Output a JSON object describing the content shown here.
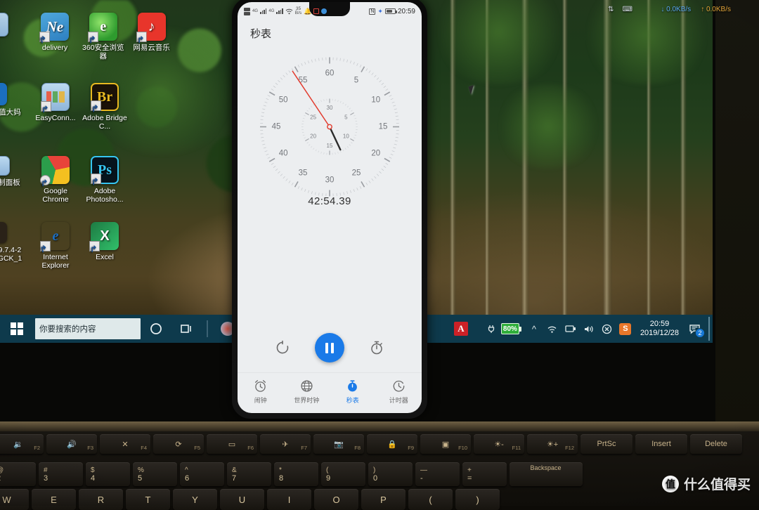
{
  "desktop": {
    "icons": [
      {
        "label": "delivery",
        "icon": "ne-delivery-icon",
        "glyph": "Ne",
        "cls": "g-delivery"
      },
      {
        "label": "360安全浏览器",
        "icon": "360-browser-icon",
        "glyph": "e",
        "cls": "g-360"
      },
      {
        "label": "网易云音乐",
        "icon": "netease-music-icon",
        "glyph": "♪",
        "cls": "g-netease"
      },
      {
        "label": "值大妈",
        "icon": "smzdm-icon",
        "glyph": "",
        "cls": "g-blue"
      },
      {
        "label": "EasyConn...",
        "icon": "easyconnect-icon",
        "glyph": "",
        "cls": "g-easyconn"
      },
      {
        "label": "Adobe Bridge C...",
        "icon": "adobe-bridge-icon",
        "glyph": "Br",
        "cls": "g-br"
      },
      {
        "label": "制面板",
        "icon": "control-panel-icon",
        "glyph": "",
        "cls": "g-panel"
      },
      {
        "label": "Google Chrome",
        "icon": "chrome-icon",
        "glyph": "",
        "cls": "g-chrome"
      },
      {
        "label": "Adobe Photosho...",
        "icon": "adobe-photoshop-icon",
        "glyph": "Ps",
        "cls": "g-ps"
      },
      {
        "label": "9.7.4-2 GCK_1",
        "icon": "folder-icon",
        "glyph": "",
        "cls": "g-blue"
      },
      {
        "label": "Internet Explorer",
        "icon": "internet-explorer-icon",
        "glyph": "e",
        "cls": "g-ie"
      },
      {
        "label": "Excel",
        "icon": "excel-icon",
        "glyph": "X",
        "cls": "g-excel"
      }
    ]
  },
  "taskbar": {
    "search_placeholder": "你要搜索的内容",
    "cortana_icon": "cortana-circle-icon",
    "taskview_icon": "task-view-icon",
    "tray": {
      "acrobat_icon": "adobe-acrobat-icon",
      "plug_icon": "power-plug-icon",
      "battery_percent": "80%",
      "chevron_icon": "chevron-up-icon",
      "wifi_icon": "wifi-icon",
      "screen_icon": "display-icon",
      "volume_icon": "volume-icon",
      "close_icon": "circle-x-icon",
      "sogou_icon": "sogou-icon"
    },
    "clock_time": "20:59",
    "clock_date": "2019/12/28",
    "notification_count": "2"
  },
  "netspeed": {
    "download": "0.0KB/s",
    "upload": "0.0KB/s",
    "down_arrow": "↓",
    "up_arrow": "↑"
  },
  "phone": {
    "statusbar": {
      "sim_label_1": "4G",
      "sim_label_2": "4G",
      "speed_value": "35",
      "speed_unit": "B/s",
      "wifi_icon": "wifi-icon",
      "bell_icon": "bell-icon",
      "square_icon": "red-square-icon",
      "blue_dot_icon": "blue-dot-icon",
      "nfc_icon": "nfc-icon",
      "bluetooth_icon": "bluetooth-icon",
      "battery_icon": "battery-icon",
      "time": "20:59"
    },
    "app_title": "秒表",
    "elapsed": "42:54.39",
    "controls": {
      "lap_icon": "lap-reset-icon",
      "pause_icon": "pause-icon",
      "stopwatch_icon": "stopwatch-icon"
    },
    "nav": [
      {
        "label": "闹钟",
        "icon": "alarm-clock-icon",
        "active": false
      },
      {
        "label": "世界时钟",
        "icon": "globe-icon",
        "active": false
      },
      {
        "label": "秒表",
        "icon": "stopwatch-icon",
        "active": true
      },
      {
        "label": "计时器",
        "icon": "timer-icon",
        "active": false
      }
    ],
    "accent_color": "#1a7ae8",
    "hand_color": "#e23b2e"
  },
  "dial": {
    "outer_ticks_labels": [
      "60",
      "5",
      "10",
      "15",
      "20",
      "25",
      "30",
      "35",
      "40",
      "45",
      "50",
      "55"
    ],
    "inner_ticks_labels": [
      "30",
      "5",
      "10",
      "15",
      "20",
      "25"
    ],
    "second_hand_value": 54.39,
    "minute_hand_value": 12.9,
    "outer_max": 60,
    "inner_max": 30
  },
  "keyboard": {
    "fn_row": [
      {
        "glyph": "🔉",
        "label": "F2",
        "name": "volume-down-key"
      },
      {
        "glyph": "🔊",
        "label": "F3",
        "name": "volume-up-key"
      },
      {
        "glyph": "✕",
        "label": "F4",
        "name": "mic-mute-key"
      },
      {
        "glyph": "⟳",
        "label": "F5",
        "name": "refresh-key"
      },
      {
        "glyph": "▭",
        "label": "F6",
        "name": "touchpad-key"
      },
      {
        "glyph": "✈",
        "label": "F7",
        "name": "airplane-mode-key"
      },
      {
        "glyph": "📷",
        "label": "F8",
        "name": "camera-key"
      },
      {
        "glyph": "🔒",
        "label": "F9",
        "name": "lock-key"
      },
      {
        "glyph": "▣",
        "label": "F10",
        "name": "display-switch-key"
      },
      {
        "glyph": "☀-",
        "label": "F11",
        "name": "brightness-down-key"
      },
      {
        "glyph": "☀+",
        "label": "F12",
        "name": "brightness-up-key"
      },
      {
        "glyph": "PrtSc",
        "label": "",
        "name": "print-screen-key"
      },
      {
        "glyph": "Insert",
        "label": "",
        "name": "insert-key"
      },
      {
        "glyph": "Delete",
        "label": "",
        "name": "delete-key"
      }
    ],
    "num_row": [
      {
        "top": "@",
        "bot": "2"
      },
      {
        "top": "#",
        "bot": "3"
      },
      {
        "top": "$",
        "bot": "4"
      },
      {
        "top": "%",
        "bot": "5"
      },
      {
        "top": "^",
        "bot": "6"
      },
      {
        "top": "&",
        "bot": "7"
      },
      {
        "top": "*",
        "bot": "8"
      },
      {
        "top": "(",
        "bot": "9"
      },
      {
        "top": ")",
        "bot": "0"
      },
      {
        "top": "—",
        "bot": "-"
      },
      {
        "top": "+",
        "bot": "="
      }
    ],
    "backspace_label": "Backspace",
    "alpha_row": [
      "W",
      "E",
      "R",
      "T",
      "Y",
      "U",
      "I",
      "O",
      "P",
      "(",
      ")"
    ]
  },
  "watermark": {
    "logo": "值",
    "text": "什么值得买"
  }
}
